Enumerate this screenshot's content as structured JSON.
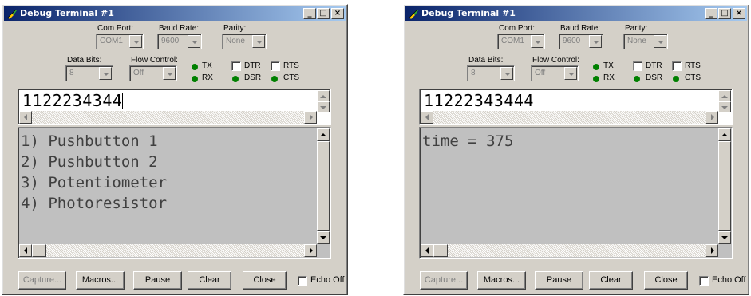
{
  "colors": {
    "titlebar_start": "#0a246a",
    "titlebar_end": "#a6caf0",
    "window_face": "#d4d0c8",
    "receive_background": "#c0c0c0",
    "led_on": "#008000"
  },
  "icons": {
    "title": "probe-icon",
    "minimize": "minimize-icon",
    "maximize": "maximize-icon",
    "close": "close-icon"
  },
  "windows": [
    {
      "title": "Debug Terminal #1",
      "com_port_label": "Com Port:",
      "com_port_value": "COM1",
      "baud_rate_label": "Baud Rate:",
      "baud_rate_value": "9600",
      "parity_label": "Parity:",
      "parity_value": "None",
      "data_bits_label": "Data Bits:",
      "data_bits_value": "8",
      "flow_control_label": "Flow Control:",
      "flow_control_value": "Off",
      "tx_label": "TX",
      "rx_label": "RX",
      "dtr_label": "DTR",
      "rts_label": "RTS",
      "dsr_label": "DSR",
      "cts_label": "CTS",
      "transmit_text": "1122234344",
      "receive_lines": [
        "1) Pushbutton 1",
        "2) Pushbutton 2",
        "3) Potentiometer",
        "4) Photoresistor"
      ],
      "buttons": {
        "capture": "Capture...",
        "macros": "Macros...",
        "pause": "Pause",
        "clear": "Clear",
        "close": "Close"
      },
      "echo_off_label": "Echo Off"
    },
    {
      "title": "Debug Terminal #1",
      "com_port_label": "Com Port:",
      "com_port_value": "COM1",
      "baud_rate_label": "Baud Rate:",
      "baud_rate_value": "9600",
      "parity_label": "Parity:",
      "parity_value": "None",
      "data_bits_label": "Data Bits:",
      "data_bits_value": "8",
      "flow_control_label": "Flow Control:",
      "flow_control_value": "Off",
      "tx_label": "TX",
      "rx_label": "RX",
      "dtr_label": "DTR",
      "rts_label": "RTS",
      "dsr_label": "DSR",
      "cts_label": "CTS",
      "transmit_text": "11222343444",
      "receive_lines": [
        "time = 375"
      ],
      "buttons": {
        "capture": "Capture...",
        "macros": "Macros...",
        "pause": "Pause",
        "clear": "Clear",
        "close": "Close"
      },
      "echo_off_label": "Echo Off"
    }
  ]
}
